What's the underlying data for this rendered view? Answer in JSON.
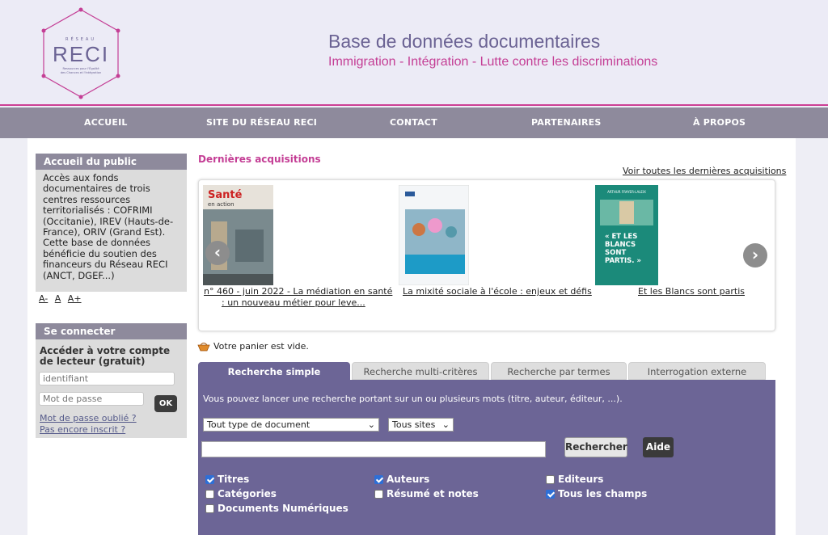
{
  "header": {
    "logo_network": "RÉSEAU",
    "logo_name": "RECI",
    "logo_tagline": "Ressources pour l'Égalité des Chances et l'Intégration",
    "title": "Base de données documentaires",
    "subtitle": "Immigration - Intégration - Lutte contre les discriminations"
  },
  "nav": [
    "ACCUEIL",
    "SITE DU RÉSEAU RECI",
    "CONTACT",
    "PARTENAIRES",
    "À PROPOS"
  ],
  "public_box": {
    "title": "Accueil du public",
    "text": "Accès aux fonds documentaires de trois centres ressources territorialisés : COFRIMI (Occitanie), IREV (Hauts-de-France), ORIV (Grand Est). Cette base de données bénéficie du soutien des financeurs du Réseau RECI (ANCT, DGEF...)"
  },
  "font_size": [
    "A-",
    "A",
    "A+"
  ],
  "login": {
    "title": "Se connecter",
    "label": "Accéder à votre compte de lecteur (gratuit)",
    "user_placeholder": "identifiant",
    "pass_placeholder": "Mot de passe",
    "ok": "OK",
    "forgot": "Mot de passe oublié ?",
    "register": "Pas encore inscrit ?"
  },
  "acquisitions": {
    "title": "Dernières acquisitions",
    "see_all": "Voir toutes les dernières acquisitions",
    "items": [
      {
        "caption1": "n° 460 - juin 2022 - La médiation en santé",
        "caption2": ": un nouveau métier pour leve...",
        "cover_title": "Santé",
        "cover_sub": "en action"
      },
      {
        "caption1": "La mixité sociale à l'école : enjeux et défis",
        "caption2": ""
      },
      {
        "caption1": "Et les Blancs sont partis",
        "caption2": "",
        "cover_author": "ARTHUR FRAYER-LALEIX",
        "cover_title": "« ET LES BLANCS SONT PARTIS. »"
      }
    ]
  },
  "basket": "Votre panier est vide.",
  "search": {
    "tabs": [
      "Recherche simple",
      "Recherche multi-critères",
      "Recherche par termes",
      "Interrogation externe"
    ],
    "hint": "Vous pouvez lancer une recherche portant sur un ou plusieurs mots (titre, auteur, éditeur, ...).",
    "doc_type": "Tout type de document",
    "sites": "Tous sites",
    "search_button": "Rechercher",
    "help_button": "Aide",
    "checkboxes": [
      {
        "label": "Titres",
        "checked": true
      },
      {
        "label": "Auteurs",
        "checked": true
      },
      {
        "label": "Editeurs",
        "checked": false
      },
      {
        "label": "Catégories",
        "checked": false
      },
      {
        "label": "Résumé et notes",
        "checked": false
      },
      {
        "label": "Tous les champs",
        "checked": true
      },
      {
        "label": "Documents Numériques",
        "checked": false
      }
    ]
  }
}
